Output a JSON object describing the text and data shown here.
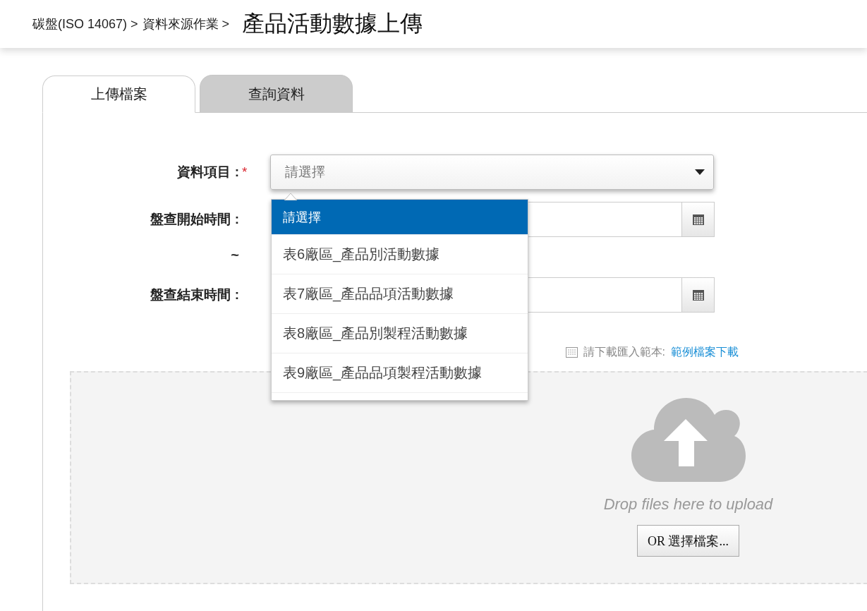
{
  "header": {
    "breadcrumb": [
      "碳盤(ISO 14067) >",
      "資料來源作業 >"
    ],
    "title": "產品活動數據上傳"
  },
  "tabs": [
    {
      "label": "上傳檔案",
      "selected": true
    },
    {
      "label": "查詢資料",
      "selected": false
    }
  ],
  "form": {
    "item": {
      "label": "資料項目 :",
      "required_mark": "*",
      "placeholder": "請選擇",
      "expanded": true,
      "options": [
        {
          "label": "請選擇",
          "selected": true
        },
        {
          "label": "表6廠區_產品別活動數據",
          "selected": false
        },
        {
          "label": "表7廠區_產品品項活動數據",
          "selected": false
        },
        {
          "label": "表8廠區_產品別製程活動數據",
          "selected": false
        },
        {
          "label": "表9廠區_產品品項製程活動數據",
          "selected": false
        }
      ]
    },
    "start": {
      "label": "盤查開始時間 :"
    },
    "separator": "~",
    "end": {
      "label": "盤查結束時間 :"
    }
  },
  "template": {
    "text": "請下載匯入範本:",
    "link": "範例檔案下載"
  },
  "dropzone": {
    "message": "Drop files here to upload",
    "button": "OR 選擇檔案..."
  }
}
